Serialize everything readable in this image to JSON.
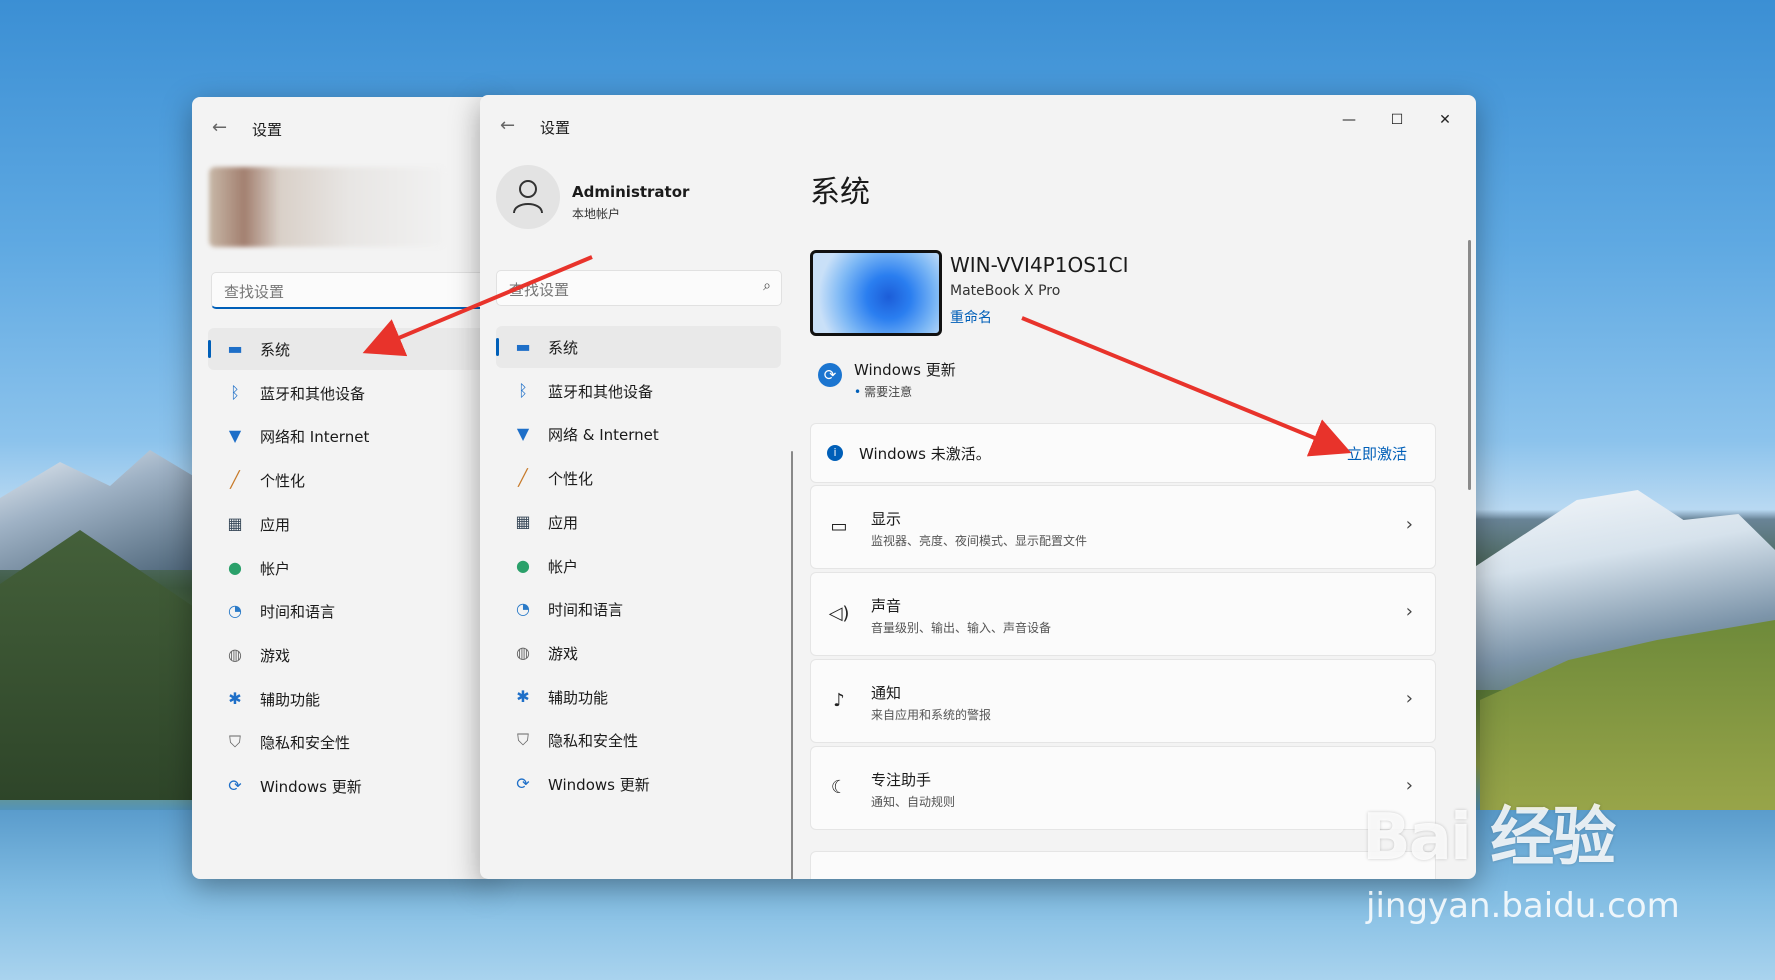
{
  "back_window": {
    "title": "设置",
    "search_placeholder": "查找设置",
    "nav": [
      {
        "label": "系统",
        "icon": "monitor-icon"
      },
      {
        "label": "蓝牙和其他设备",
        "icon": "bluetooth-icon"
      },
      {
        "label": "网络和 Internet",
        "icon": "wifi-icon"
      },
      {
        "label": "个性化",
        "icon": "brush-icon"
      },
      {
        "label": "应用",
        "icon": "apps-icon"
      },
      {
        "label": "帐户",
        "icon": "account-icon"
      },
      {
        "label": "时间和语言",
        "icon": "clock-icon"
      },
      {
        "label": "游戏",
        "icon": "gamepad-icon"
      },
      {
        "label": "辅助功能",
        "icon": "accessibility-icon"
      },
      {
        "label": "隐私和安全性",
        "icon": "shield-icon"
      },
      {
        "label": "Windows 更新",
        "icon": "update-icon"
      }
    ]
  },
  "front_window": {
    "title": "设置",
    "controls": {
      "minimize": "—",
      "maximize": "☐",
      "close": "✕"
    },
    "profile": {
      "name": "Administrator",
      "account_type": "本地帐户"
    },
    "search_placeholder": "查找设置",
    "nav": [
      {
        "label": "系统",
        "icon": "monitor-icon"
      },
      {
        "label": "蓝牙和其他设备",
        "icon": "bluetooth-icon"
      },
      {
        "label": "网络 & Internet",
        "icon": "wifi-icon"
      },
      {
        "label": "个性化",
        "icon": "brush-icon"
      },
      {
        "label": "应用",
        "icon": "apps-icon"
      },
      {
        "label": "帐户",
        "icon": "account-icon"
      },
      {
        "label": "时间和语言",
        "icon": "clock-icon"
      },
      {
        "label": "游戏",
        "icon": "gamepad-icon"
      },
      {
        "label": "辅助功能",
        "icon": "accessibility-icon"
      },
      {
        "label": "隐私和安全性",
        "icon": "shield-icon"
      },
      {
        "label": "Windows 更新",
        "icon": "update-icon"
      }
    ],
    "page": {
      "title": "系统",
      "device_name": "WIN-VVI4P1OS1CI",
      "device_model": "MateBook X Pro",
      "rename": "重命名",
      "windows_update": {
        "title": "Windows 更新",
        "status": "需要注意"
      },
      "activation": {
        "text": "Windows 未激活。",
        "action": "立即激活"
      },
      "settings": [
        {
          "title": "显示",
          "subtitle": "监视器、亮度、夜间模式、显示配置文件",
          "icon": "display-icon"
        },
        {
          "title": "声音",
          "subtitle": "音量级别、输出、输入、声音设备",
          "icon": "speaker-icon"
        },
        {
          "title": "通知",
          "subtitle": "来自应用和系统的警报",
          "icon": "bell-icon"
        },
        {
          "title": "专注助手",
          "subtitle": "通知、自动规则",
          "icon": "moon-icon"
        }
      ]
    }
  },
  "watermark": {
    "brand": "Bai 经验",
    "url": "jingyan.baidu.com"
  },
  "colors": {
    "accent": "#005fb8",
    "annotation_arrow": "#e8332b",
    "window_bg": "#f3f3f3"
  }
}
